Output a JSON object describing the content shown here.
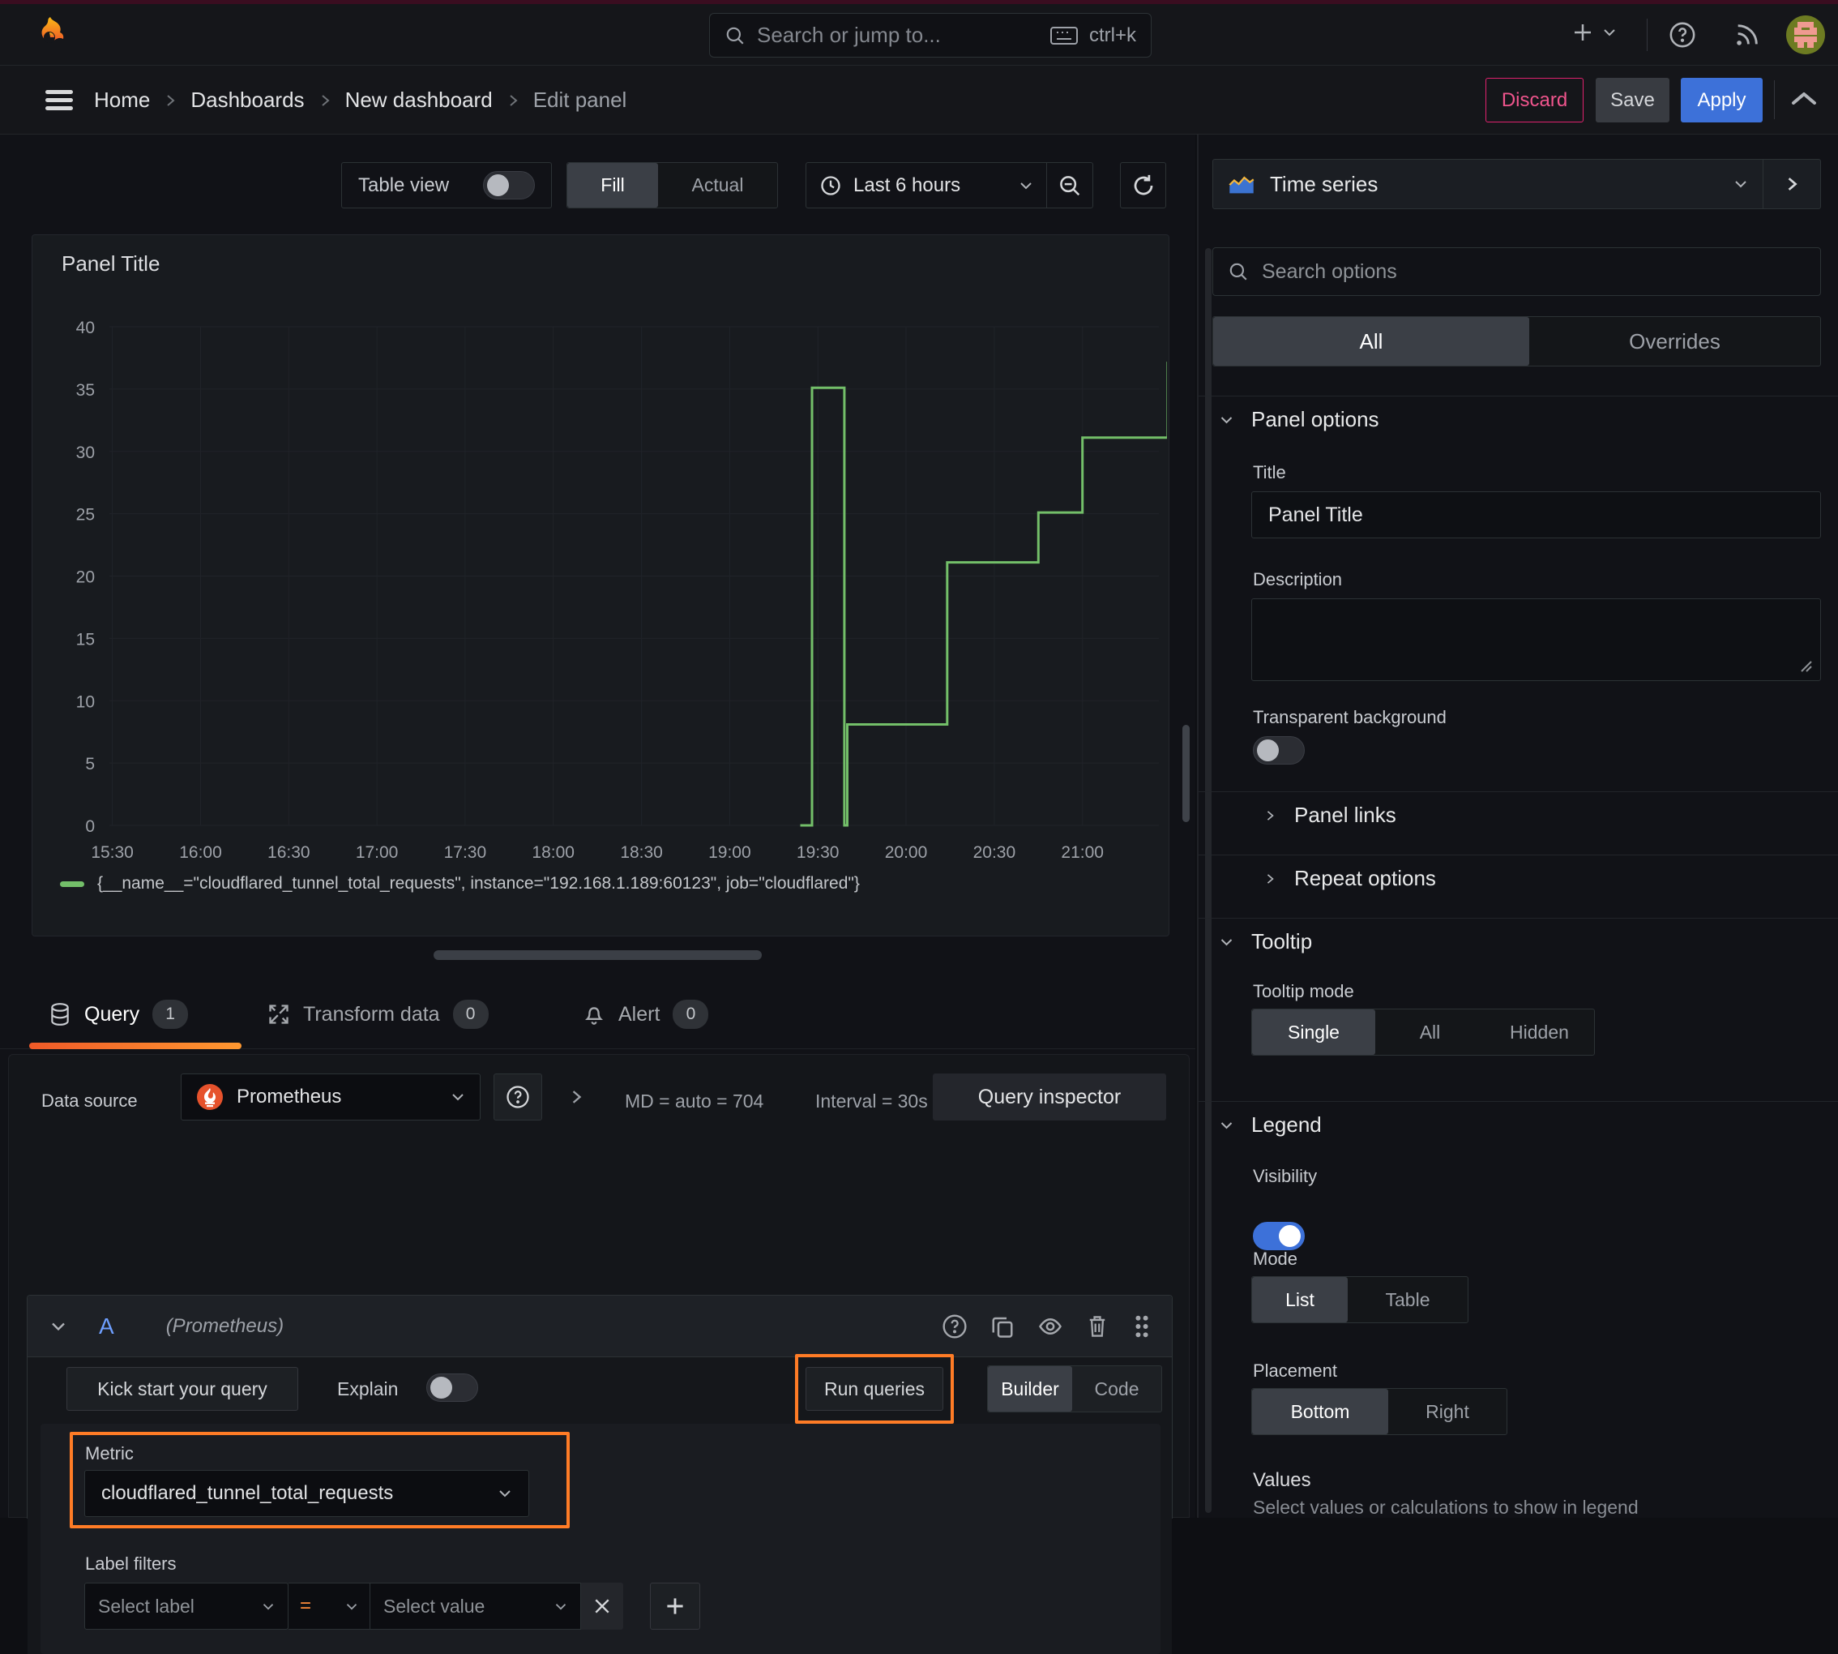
{
  "topbar": {
    "search_placeholder": "Search or jump to...",
    "search_shortcut": "ctrl+k"
  },
  "breadcrumb": {
    "items": [
      "Home",
      "Dashboards",
      "New dashboard"
    ],
    "current": "Edit panel"
  },
  "header_actions": {
    "discard": "Discard",
    "save": "Save",
    "apply": "Apply"
  },
  "toolbar": {
    "table_view_label": "Table view",
    "fill": "Fill",
    "actual": "Actual",
    "time_range": "Last 6 hours"
  },
  "panel": {
    "title": "Panel Title"
  },
  "chart_data": {
    "type": "line",
    "title": "Panel Title",
    "line_color": "#73bf69",
    "grid": true,
    "legend_position": "bottom",
    "series_label": "{__name__=\"cloudflared_tunnel_total_requests\", instance=\"192.168.1.189:60123\", job=\"cloudflared\"}",
    "x_ticks": [
      "15:30",
      "16:00",
      "16:30",
      "17:00",
      "17:30",
      "18:00",
      "18:30",
      "19:00",
      "19:30",
      "20:00",
      "20:30",
      "21:00"
    ],
    "x_domain_minutes": [
      929,
      1286
    ],
    "y_ticks": [
      0,
      5,
      10,
      15,
      20,
      25,
      30,
      35,
      40
    ],
    "y_range": [
      0,
      40
    ],
    "points_minutes_value": [
      [
        1164,
        0
      ],
      [
        1168,
        0
      ],
      [
        1168,
        35.1
      ],
      [
        1179,
        35.1
      ],
      [
        1179,
        0
      ],
      [
        1180,
        0
      ],
      [
        1180,
        8.1
      ],
      [
        1214,
        8.1
      ],
      [
        1214,
        21.1
      ],
      [
        1245,
        21.1
      ],
      [
        1245,
        25.1
      ],
      [
        1260,
        25.1
      ],
      [
        1260,
        31.1
      ],
      [
        1289,
        31.1
      ],
      [
        1289,
        37.1
      ],
      [
        1290.5,
        37.1
      ]
    ]
  },
  "tabs": {
    "query": {
      "label": "Query",
      "count": "1"
    },
    "transform": {
      "label": "Transform data",
      "count": "0"
    },
    "alert": {
      "label": "Alert",
      "count": "0"
    }
  },
  "query_editor": {
    "datasource_label": "Data source",
    "datasource_value": "Prometheus",
    "stats_md": "MD = auto = 704",
    "stats_interval": "Interval = 30s",
    "query_inspector": "Query inspector",
    "ref_id": "A",
    "ref_ds": "(Prometheus)",
    "kick_start": "Kick start your query",
    "explain": "Explain",
    "run_queries": "Run queries",
    "builder": "Builder",
    "code": "Code",
    "metric_label": "Metric",
    "metric_value": "cloudflared_tunnel_total_requests",
    "label_filters_label": "Label filters",
    "select_label_placeholder": "Select label",
    "operator": "=",
    "select_value_placeholder": "Select value"
  },
  "options": {
    "viz_type": "Time series",
    "search_placeholder": "Search options",
    "tab_all": "All",
    "tab_overrides": "Overrides",
    "panel_options": {
      "title": "Panel options",
      "title_label": "Title",
      "title_value": "Panel Title",
      "description_label": "Description",
      "transparent_label": "Transparent background"
    },
    "panel_links": "Panel links",
    "repeat_options": "Repeat options",
    "tooltip": {
      "title": "Tooltip",
      "mode_label": "Tooltip mode",
      "modes": [
        "Single",
        "All",
        "Hidden"
      ],
      "active": "Single"
    },
    "legend": {
      "title": "Legend",
      "visibility_label": "Visibility",
      "mode_label": "Mode",
      "modes": [
        "List",
        "Table"
      ],
      "active_mode": "List",
      "placement_label": "Placement",
      "placements": [
        "Bottom",
        "Right"
      ],
      "active_placement": "Bottom",
      "values_label": "Values",
      "values_help": "Select values or calculations to show in legend"
    }
  },
  "colors": {
    "accent_orange": "#ff7c26",
    "line_green": "#73bf69",
    "primary_blue": "#3d71d9",
    "danger_pink": "#e0226e"
  }
}
